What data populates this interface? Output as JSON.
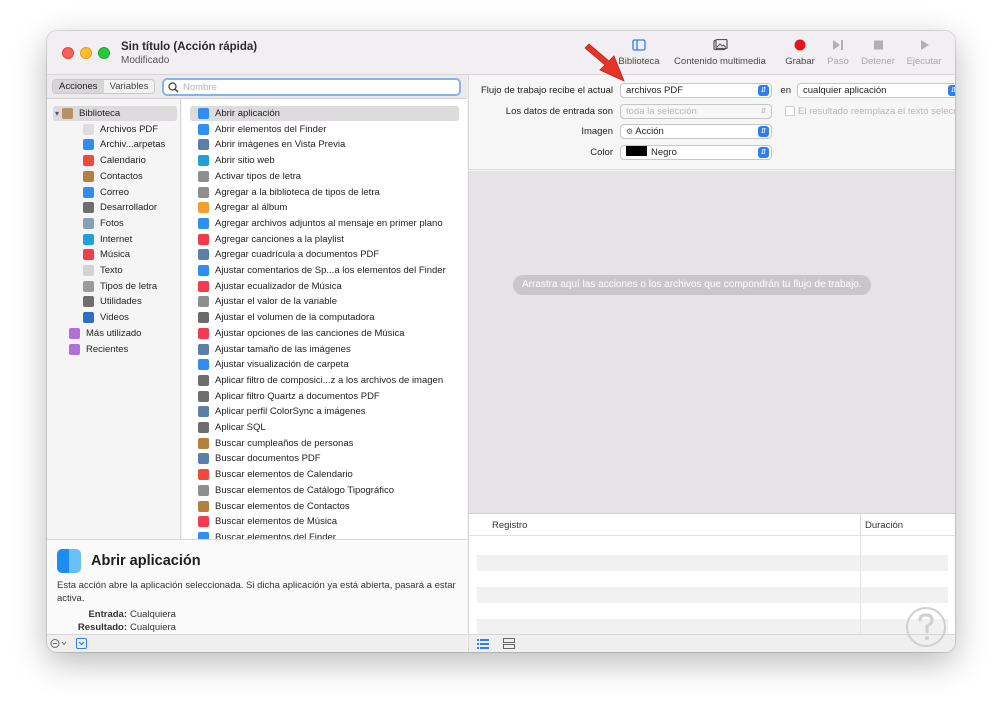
{
  "window": {
    "title": "Sin título (Acción rápida)",
    "subtitle": "Modificado"
  },
  "toolbar": {
    "buttons": [
      {
        "label": "Biblioteca",
        "icon": "sidebar-icon",
        "enabled": true
      },
      {
        "label": "Contenido multimedia",
        "icon": "photos-icon",
        "enabled": true
      },
      {
        "label": "Grabar",
        "icon": "record-icon",
        "enabled": true
      },
      {
        "label": "Paso",
        "icon": "step-icon",
        "enabled": false
      },
      {
        "label": "Detener",
        "icon": "stop-icon",
        "enabled": false
      },
      {
        "label": "Ejecutar",
        "icon": "play-icon",
        "enabled": false
      }
    ],
    "record_color": "#e8141b"
  },
  "left_toolbar": {
    "tabs": [
      "Acciones",
      "Variables"
    ],
    "active_tab": "Acciones",
    "search_placeholder": "Nombre",
    "search_value": ""
  },
  "library": [
    {
      "label": "Biblioteca",
      "icon": "library-icon",
      "level": 0,
      "selected": true,
      "expanded": true,
      "color": "#b79066"
    },
    {
      "label": "Archivos PDF",
      "icon": "pdf-icon",
      "level": 1,
      "color": "#dedcde"
    },
    {
      "label": "Archiv...arpetas",
      "icon": "finder-icon",
      "level": 1,
      "color": "#2f8ef0"
    },
    {
      "label": "Calendario",
      "icon": "calendar-icon",
      "level": 1,
      "color": "#f04a3e"
    },
    {
      "label": "Contactos",
      "icon": "contacts-icon",
      "level": 1,
      "color": "#b5803d"
    },
    {
      "label": "Correo",
      "icon": "mail-icon",
      "level": 1,
      "color": "#2f8ef0"
    },
    {
      "label": "Desarrollador",
      "icon": "developer-icon",
      "level": 1,
      "color": "#6e6e6e"
    },
    {
      "label": "Fotos",
      "icon": "photos-icon",
      "level": 1,
      "color": "#8a9fb8"
    },
    {
      "label": "Internet",
      "icon": "internet-icon",
      "level": 1,
      "color": "#1fa0d8"
    },
    {
      "label": "Música",
      "icon": "music-icon",
      "level": 1,
      "color": "#f23b50"
    },
    {
      "label": "Texto",
      "icon": "text-icon",
      "level": 1,
      "color": "#d4d2d4"
    },
    {
      "label": "Tipos de letra",
      "icon": "fonts-icon",
      "level": 1,
      "color": "#9b9b9b"
    },
    {
      "label": "Utilidades",
      "icon": "utilities-icon",
      "level": 1,
      "color": "#6e6e6e"
    },
    {
      "label": "Videos",
      "icon": "videos-icon",
      "level": 1,
      "color": "#2f6dc8"
    },
    {
      "label": "Más utilizado",
      "icon": "smart-folder-icon",
      "level": 0,
      "color": "#b26fd8"
    },
    {
      "label": "Recientes",
      "icon": "smart-folder-icon",
      "level": 0,
      "color": "#b26fd8"
    }
  ],
  "actions": [
    {
      "label": "Abrir aplicación",
      "icon": "finder-icon",
      "color": "#2f8ef0",
      "selected": true
    },
    {
      "label": "Abrir elementos del Finder",
      "icon": "finder-icon",
      "color": "#2f8ef0"
    },
    {
      "label": "Abrir imágenes en Vista Previa",
      "icon": "preview-icon",
      "color": "#5a7fa8"
    },
    {
      "label": "Abrir sitio web",
      "icon": "safari-icon",
      "color": "#1fa0d8"
    },
    {
      "label": "Activar tipos de letra",
      "icon": "fontbook-icon",
      "color": "#8e8e8e"
    },
    {
      "label": "Agregar a la biblioteca de tipos de letra",
      "icon": "fontbook-icon",
      "color": "#8e8e8e"
    },
    {
      "label": "Agregar al álbum",
      "icon": "photos-icon",
      "color": "#f0a030"
    },
    {
      "label": "Agregar archivos adjuntos al mensaje en primer plano",
      "icon": "mail-icon",
      "color": "#2f8ef0"
    },
    {
      "label": "Agregar canciones a la playlist",
      "icon": "music-icon",
      "color": "#f23b50"
    },
    {
      "label": "Agregar cuadrícula a documentos PDF",
      "icon": "preview-icon",
      "color": "#5a7fa8"
    },
    {
      "label": "Ajustar comentarios de Sp...a los elementos del Finder",
      "icon": "finder-icon",
      "color": "#2f8ef0"
    },
    {
      "label": "Ajustar ecualizador de Música",
      "icon": "music-icon",
      "color": "#f23b50"
    },
    {
      "label": "Ajustar el valor de la variable",
      "icon": "automator-icon",
      "color": "#8e8e8e"
    },
    {
      "label": "Ajustar el volumen de la computadora",
      "icon": "volume-icon",
      "color": "#6a6a6a"
    },
    {
      "label": "Ajustar opciones de las canciones de Música",
      "icon": "music-icon",
      "color": "#f23b50"
    },
    {
      "label": "Ajustar tamaño de las imágenes",
      "icon": "preview-icon",
      "color": "#5a7fa8"
    },
    {
      "label": "Ajustar visualización de carpeta",
      "icon": "finder-icon",
      "color": "#2f8ef0"
    },
    {
      "label": "Aplicar filtro de composici...z a los archivos de imagen",
      "icon": "developer-icon",
      "color": "#6e6e6e"
    },
    {
      "label": "Aplicar filtro Quartz a documentos PDF",
      "icon": "developer-icon",
      "color": "#6e6e6e"
    },
    {
      "label": "Aplicar perfil ColorSync a imágenes",
      "icon": "preview-icon",
      "color": "#5a7fa8"
    },
    {
      "label": "Aplicar SQL",
      "icon": "developer-icon",
      "color": "#6e6e6e"
    },
    {
      "label": "Buscar cumpleaños de personas",
      "icon": "contacts-icon",
      "color": "#b5803d"
    },
    {
      "label": "Buscar documentos PDF",
      "icon": "preview-icon",
      "color": "#5a7fa8"
    },
    {
      "label": "Buscar elementos de Calendario",
      "icon": "calendar-icon",
      "color": "#f04a3e"
    },
    {
      "label": "Buscar elementos de Catálogo Tipográfico",
      "icon": "fontbook-icon",
      "color": "#8e8e8e"
    },
    {
      "label": "Buscar elementos de Contactos",
      "icon": "contacts-icon",
      "color": "#b5803d"
    },
    {
      "label": "Buscar elementos de Música",
      "icon": "music-icon",
      "color": "#f23b50"
    },
    {
      "label": "Buscar elementos del Finder",
      "icon": "finder-icon",
      "color": "#2f8ef0"
    }
  ],
  "description": {
    "title": "Abrir aplicación",
    "text": "Esta acción abre la aplicación seleccionada. Si dicha aplicación ya está abierta, pasará a estar activa.",
    "input_label": "Entrada:",
    "input_value": "Cualquiera",
    "output_label": "Resultado:",
    "output_value": "Cualquiera"
  },
  "workflow": {
    "receives_label": "Flujo de trabajo recibe el actual",
    "receives_value": "archivos PDF",
    "in_label": "en",
    "in_value": "cualquier aplicación",
    "input_label": "Los datos de entrada son",
    "input_value": "toda la selección",
    "replace_label": "El resultado reemplaza el texto seleccionado",
    "image_label": "Imagen",
    "image_value": "Acción",
    "color_label": "Color",
    "color_value": "Negro",
    "color_swatch": "#000000",
    "drop_hint": "Arrastra aquí las acciones o los archivos que compondrán tu flujo de trabajo."
  },
  "log": {
    "col_log": "Registro",
    "col_duration": "Duración"
  },
  "annotation_arrow_color": "#e8332b"
}
